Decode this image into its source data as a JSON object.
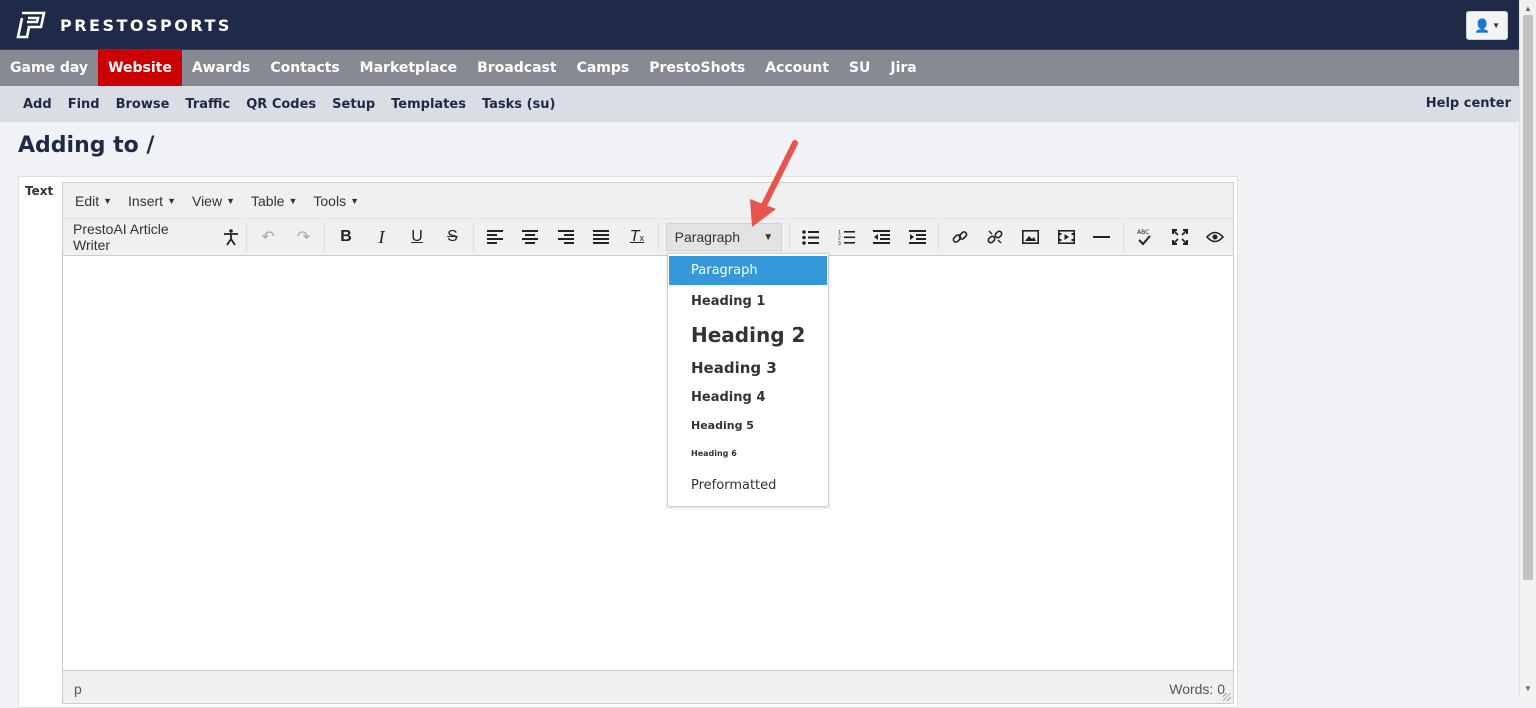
{
  "brand": {
    "name": "PRESTOSPORTS"
  },
  "main_nav": [
    "Game day",
    "Website",
    "Awards",
    "Contacts",
    "Marketplace",
    "Broadcast",
    "Camps",
    "PrestoShots",
    "Account",
    "SU",
    "Jira"
  ],
  "main_nav_active": "Website",
  "sub_nav": [
    "Add",
    "Find",
    "Browse",
    "Traffic",
    "QR Codes",
    "Setup",
    "Templates",
    "Tasks (su)"
  ],
  "help_center": "Help center",
  "page": {
    "title": "Adding to /",
    "field_label": "Text"
  },
  "editor": {
    "menu": [
      "Edit",
      "Insert",
      "View",
      "Table",
      "Tools"
    ],
    "toolbar": {
      "ai_writer": "PrestoAI Article Writer",
      "format_value": "Paragraph"
    },
    "status_path": "p",
    "word_count": "Words: 0"
  },
  "format_dropdown": {
    "selected": "Paragraph",
    "options": [
      "Paragraph",
      "Heading 1",
      "Heading 2",
      "Heading 3",
      "Heading 4",
      "Heading 5",
      "Heading 6",
      "Preformatted"
    ]
  },
  "icons": {
    "accessibility": "accessibility-icon",
    "undo": "undo-icon",
    "redo": "redo-icon",
    "bold": "bold-icon",
    "italic": "italic-icon",
    "underline": "underline-icon",
    "strikethrough": "strikethrough-icon",
    "align_left": "align-left-icon",
    "align_center": "align-center-icon",
    "align_right": "align-right-icon",
    "align_justify": "align-justify-icon",
    "clear_format": "clear-format-icon",
    "bullet_list": "bullet-list-icon",
    "numbered_list": "numbered-list-icon",
    "outdent": "outdent-icon",
    "indent": "indent-icon",
    "link": "link-icon",
    "unlink": "unlink-icon",
    "image": "image-icon",
    "media": "media-icon",
    "hr": "horizontal-rule-icon",
    "spellcheck": "spellcheck-icon",
    "fullscreen": "fullscreen-icon",
    "preview": "preview-icon",
    "user": "user-icon"
  },
  "colors": {
    "header_bg": "#1e2a47",
    "nav_bg": "#878a93",
    "active": "#cc0000",
    "subnav_bg": "#dadde4",
    "selected_option": "#3498db",
    "annotation_arrow": "#e8544a"
  }
}
